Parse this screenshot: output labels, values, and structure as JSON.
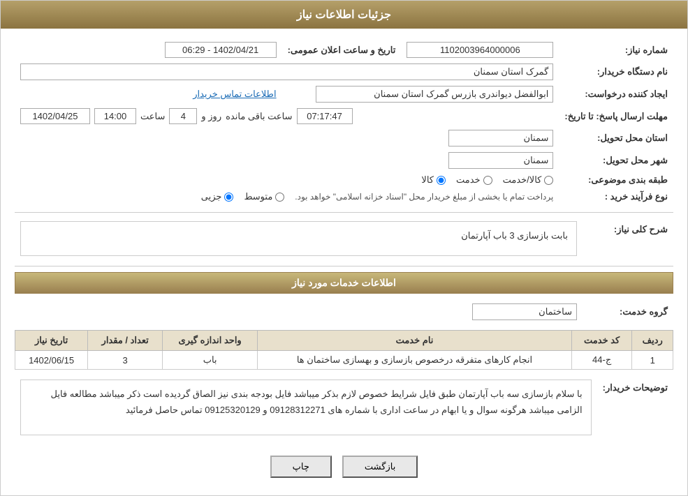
{
  "page": {
    "title": "جزئیات اطلاعات نیاز",
    "sections": {
      "main_info": "جزئیات اطلاعات نیاز",
      "service_info": "اطلاعات خدمات مورد نیاز"
    }
  },
  "fields": {
    "need_number_label": "شماره نیاز:",
    "need_number_value": "1102003964000006",
    "buyer_org_label": "نام دستگاه خریدار:",
    "buyer_org_value": "گمرک استان سمنان",
    "creator_label": "ایجاد کننده درخواست:",
    "creator_value": "ابوالفضل دیواندری بازرس گمرک استان سمنان",
    "contact_link": "اطلاعات تماس خریدار",
    "deadline_label": "مهلت ارسال پاسخ: تا تاریخ:",
    "announce_label": "تاریخ و ساعت اعلان عمومی:",
    "announce_date": "1402/04/21 - 06:29",
    "deadline_date": "1402/04/25",
    "deadline_time_label": "ساعت",
    "deadline_time": "14:00",
    "deadline_days_label": "روز و",
    "deadline_days": "4",
    "countdown_label": "ساعت باقی مانده",
    "countdown_value": "07:17:47",
    "province_delivery_label": "استان محل تحویل:",
    "province_delivery_value": "سمنان",
    "city_delivery_label": "شهر محل تحویل:",
    "city_delivery_value": "سمنان",
    "category_label": "طبقه بندی موضوعی:",
    "category_options": [
      "کالا",
      "خدمت",
      "کالا/خدمت"
    ],
    "category_selected": "کالا",
    "purchase_type_label": "نوع فرآیند خرید :",
    "purchase_type_options": [
      "جزیی",
      "متوسط"
    ],
    "purchase_type_note": "پرداخت تمام یا بخشی از مبلغ خریدار محل \"اسناد خزانه اسلامی\" خواهد بود.",
    "need_desc_label": "شرح کلی نیاز:",
    "need_desc_value": "بابت بازسازی 3 باب آپارتمان",
    "service_group_label": "گروه خدمت:",
    "service_group_value": "ساختمان"
  },
  "table": {
    "headers": [
      "ردیف",
      "کد خدمت",
      "نام خدمت",
      "واحد اندازه گیری",
      "تعداد / مقدار",
      "تاریخ نیاز"
    ],
    "rows": [
      {
        "row": "1",
        "code": "ج-44",
        "name": "انجام کارهای متفرقه درخصوص بازسازی و بهسازی ساختمان ها",
        "unit": "باب",
        "count": "3",
        "date": "1402/06/15"
      }
    ]
  },
  "buyer_desc_label": "توضیحات خریدار:",
  "buyer_desc_value": "با سلام  بازسازی سه باب آپارتمان طبق  فایل شرایط خصوص  لازم بذکر میباشد فایل بودجه بندی نیز الصاق گردیده است ذکر میباشد مطالعه فایل الزامی میباشد  هرگونه سوال و یا ابهام در ساعت اداری با شماره های 09128312271 و 09125320129 تماس حاصل فرمائید",
  "buttons": {
    "print": "چاپ",
    "back": "بازگشت"
  }
}
